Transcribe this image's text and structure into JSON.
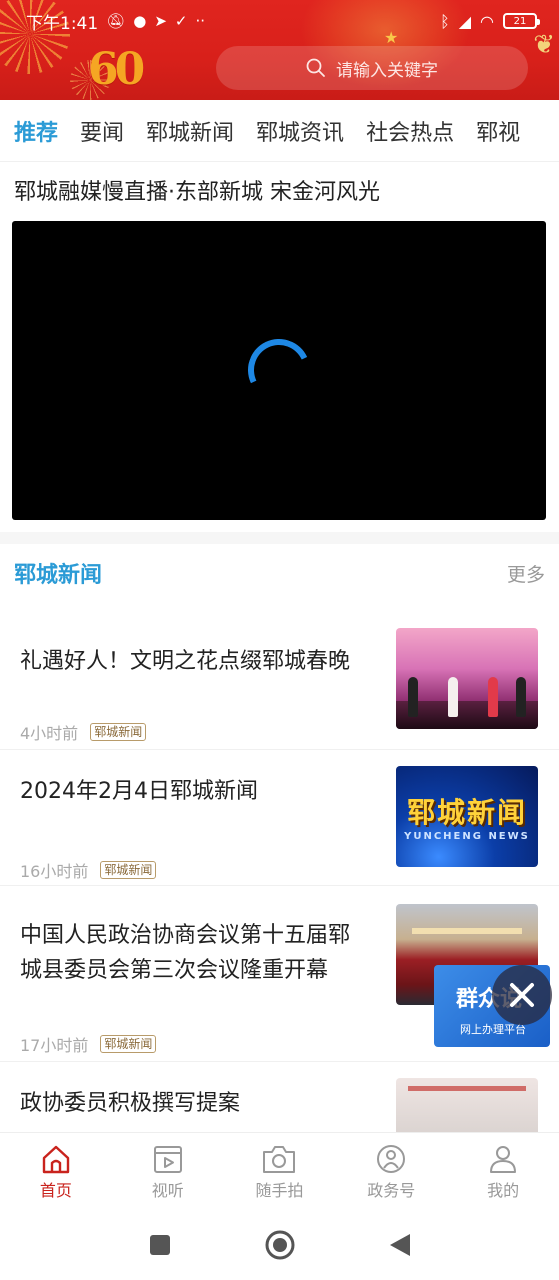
{
  "status_bar": {
    "time": "下午1:41",
    "battery": "21"
  },
  "search": {
    "placeholder": "请输入关键字"
  },
  "tabs": [
    {
      "label": "推荐",
      "active": true
    },
    {
      "label": "要闻"
    },
    {
      "label": "郓城新闻"
    },
    {
      "label": "郓城资讯"
    },
    {
      "label": "社会热点"
    },
    {
      "label": "郓视"
    }
  ],
  "live": {
    "title": "郓城融媒慢直播·东部新城  宋金河风光"
  },
  "section": {
    "title": "郓城新闻",
    "more": "更多"
  },
  "news": [
    {
      "title": "礼遇好人！文明之花点缀郓城春晚",
      "time": "4小时前",
      "tag": "郓城新闻"
    },
    {
      "title": "2024年2月4日郓城新闻",
      "time": "16小时前",
      "tag": "郓城新闻"
    },
    {
      "title": "中国人民政治协商会议第十五届郓城县委员会第三次会议隆重开幕",
      "time": "17小时前",
      "tag": "郓城新闻"
    },
    {
      "title": "政协委员积极撰写提案"
    }
  ],
  "thumb_news": {
    "big": "郓城新闻",
    "small": "YUNCHENG NEWS"
  },
  "float_widget": {
    "title": "群众说",
    "subtitle": "网上办理平台"
  },
  "bottom_nav": [
    {
      "label": "首页",
      "icon": "home-icon",
      "active": true
    },
    {
      "label": "视听",
      "icon": "video-icon"
    },
    {
      "label": "随手拍",
      "icon": "camera-icon"
    },
    {
      "label": "政务号",
      "icon": "gov-icon"
    },
    {
      "label": "我的",
      "icon": "user-icon"
    }
  ],
  "colors": {
    "brand_red": "#d8201a",
    "accent_blue": "#2b9bd6",
    "nav_active": "#c9231d"
  }
}
